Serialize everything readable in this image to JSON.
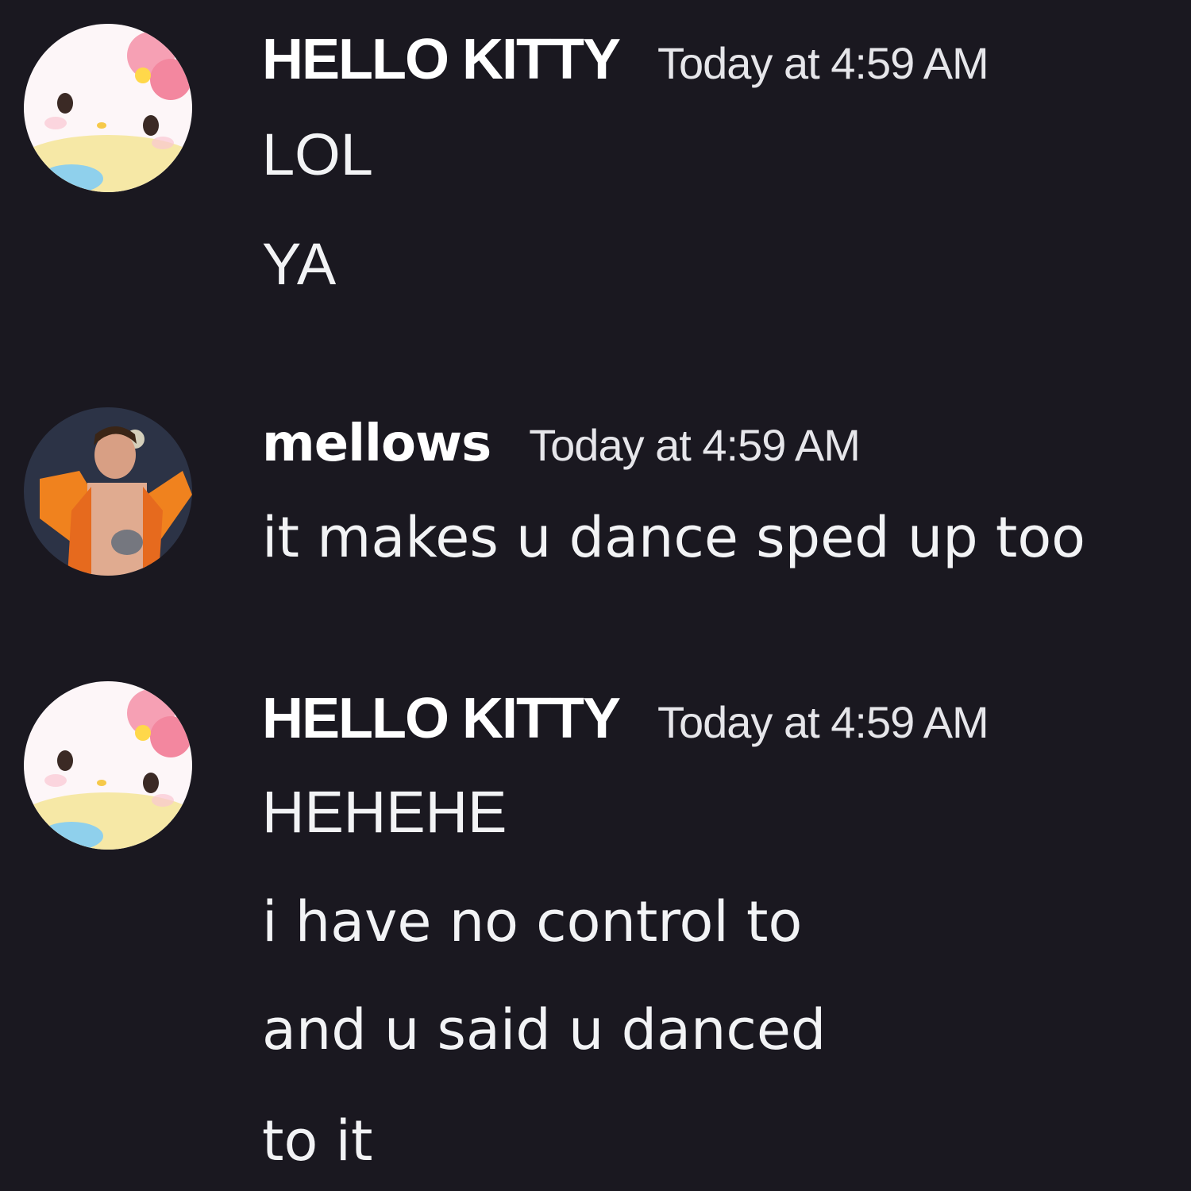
{
  "messages": [
    {
      "username": "HELLO KITTY",
      "timestamp": "Today at 4:59 AM",
      "avatar_icon": "hello-kitty-avatar-icon",
      "lines": [
        "LOL",
        "YA"
      ]
    },
    {
      "username": "mellows",
      "timestamp": "Today at 4:59 AM",
      "avatar_icon": "performer-photo-avatar-icon",
      "lines": [
        "it makes u dance sped up too"
      ]
    },
    {
      "username": "HELLO KITTY",
      "timestamp": "Today at 4:59 AM",
      "avatar_icon": "hello-kitty-avatar-icon",
      "lines": [
        "HEHEHE",
        "i have no control to",
        "and u said u danced",
        "to it"
      ]
    }
  ],
  "colors": {
    "background": "#1a1820",
    "text": "#f2f3f5",
    "username": "#ffffff"
  }
}
